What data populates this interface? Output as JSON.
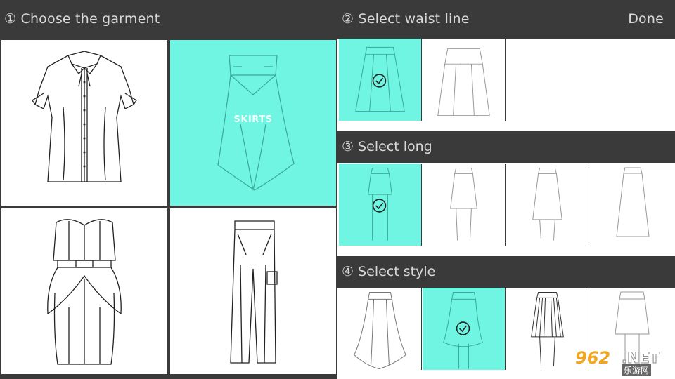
{
  "left": {
    "header": "① Choose the garment",
    "garments": [
      {
        "name": "blouse",
        "selected": false,
        "label": ""
      },
      {
        "name": "skirts",
        "selected": true,
        "label": "SKIRTS"
      },
      {
        "name": "dress",
        "selected": false,
        "label": ""
      },
      {
        "name": "pants",
        "selected": false,
        "label": ""
      }
    ]
  },
  "right": {
    "waist": {
      "header": "② Select waist line",
      "done_label": "Done",
      "options": [
        {
          "selected": true
        },
        {
          "selected": false
        }
      ]
    },
    "long": {
      "header": "③ Select long",
      "options": [
        {
          "selected": true
        },
        {
          "selected": false
        },
        {
          "selected": false
        },
        {
          "selected": false
        }
      ]
    },
    "style": {
      "header": "④ Select style",
      "options": [
        {
          "selected": false
        },
        {
          "selected": true
        },
        {
          "selected": false
        },
        {
          "selected": false
        }
      ]
    }
  },
  "watermark": {
    "number": "962",
    "domain": ".NET",
    "cn": "乐游网"
  },
  "colors": {
    "selected": "#6ff5e1",
    "header_bg": "#3a3a3a",
    "header_text": "#d8d8d8"
  }
}
